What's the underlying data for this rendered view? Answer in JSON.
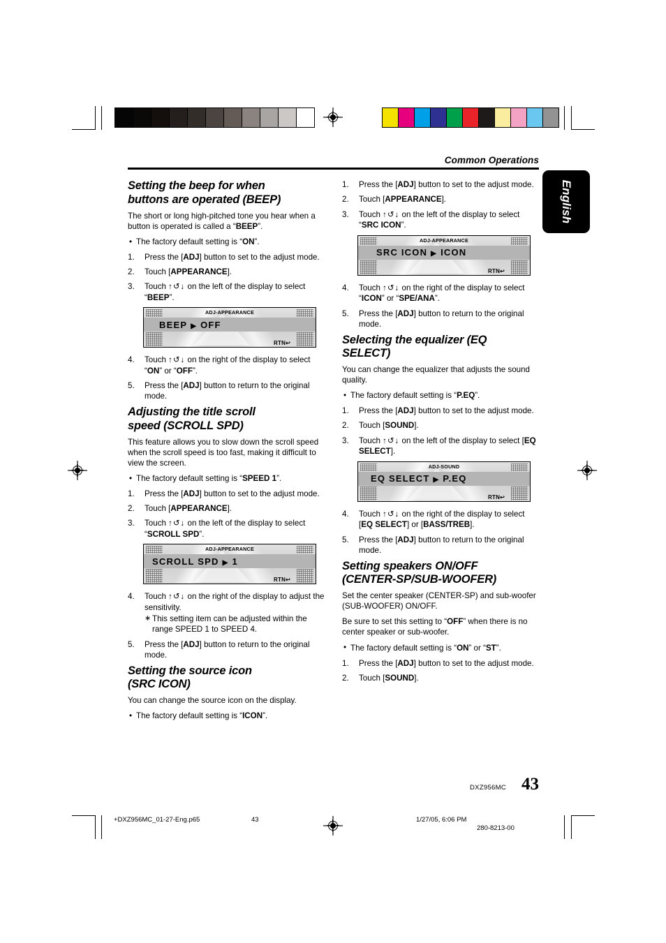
{
  "header": {
    "running_head": "Common Operations",
    "language_tab": "English"
  },
  "footer": {
    "model": "DXZ956MC",
    "page_number": "43",
    "slug_file": "+DXZ956MC_01-27-Eng.p65",
    "slug_page": "43",
    "slug_date": "1/27/05, 6:06 PM",
    "slug_code": "280-8213-00"
  },
  "calibration": {
    "gray_bar": [
      "#050505",
      "#0b0907",
      "#140f0c",
      "#241f1c",
      "#332d29",
      "#4c4441",
      "#645b57",
      "#8a8380",
      "#a9a5a2",
      "#ccc8c6",
      "#ffffff"
    ],
    "color_bar": [
      "#f5e200",
      "#e6007e",
      "#00a0e9",
      "#2e3192",
      "#00a04b",
      "#e8242a",
      "#1e1a19",
      "#faeda0",
      "#f4a3c4",
      "#6ac8f0",
      "#939393"
    ]
  },
  "sections": [
    {
      "id": "beep",
      "column": "left",
      "title": "Setting the beep for when buttons are operated (BEEP)",
      "paragraphs": [
        "The short or long high-pitched tone you hear when a button is operated is called a “BEEP”."
      ],
      "bullets": [
        "The factory default setting is “ON”."
      ],
      "steps": [
        {
          "num": "1.",
          "text": "Press the [ADJ] button to set to the adjust mode."
        },
        {
          "num": "2.",
          "text": "Touch [APPEARANCE]."
        },
        {
          "num": "3.",
          "text": "Touch ↑↺↓ on the left of the display to select “BEEP”."
        },
        {
          "num": "4.",
          "text": "Touch ↑↺↓ on the right of the display to select “ON” or “OFF”."
        },
        {
          "num": "5.",
          "text": "Press the [ADJ] button to return to the original mode."
        }
      ],
      "lcd": {
        "title": "ADJ-APPEARANCE",
        "param": "BEEP",
        "arrow": "▶",
        "value": "OFF",
        "rtn": "RTN↩"
      }
    },
    {
      "id": "scroll-spd",
      "column": "left",
      "title": "Adjusting the title scroll speed (SCROLL SPD)",
      "paragraphs": [
        "This feature allows you to slow down the scroll speed when the scroll speed is too fast, making it difficult to view the screen."
      ],
      "bullets": [
        "The factory default setting is “SPEED 1”."
      ],
      "steps": [
        {
          "num": "1.",
          "text": "Press the [ADJ] button to set to the adjust mode."
        },
        {
          "num": "2.",
          "text": "Touch [APPEARANCE]."
        },
        {
          "num": "3.",
          "text": "Touch ↑↺↓ on the left of the display to select “SCROLL SPD”."
        },
        {
          "num": "4.",
          "text": "Touch ↑↺↓ on the right of the display to adjust the sensitivity.",
          "substep": "This setting item can be adjusted within the range SPEED 1 to SPEED 4."
        },
        {
          "num": "5.",
          "text": "Press the [ADJ] button to return to the original mode."
        }
      ],
      "lcd": {
        "title": "ADJ-APPEARANCE",
        "param": "SCROLL SPD",
        "arrow": "▶",
        "value": "1",
        "rtn": "RTN↩"
      }
    },
    {
      "id": "src-icon",
      "column": "left-right",
      "title": "Setting the source icon (SRC ICON)",
      "paragraphs": [
        "You can change the source icon on the display."
      ],
      "bullets": [
        "The factory default setting is “ICON”."
      ],
      "steps": [
        {
          "num": "1.",
          "text": "Press the [ADJ] button to set to the adjust mode."
        },
        {
          "num": "2.",
          "text": "Touch [APPEARANCE]."
        },
        {
          "num": "3.",
          "text": "Touch ↑↺↓ on the left of the display to select “SRC ICON”."
        },
        {
          "num": "4.",
          "text": "Touch ↑↺↓ on the right of the display to select “ICON” or “SPE/ANA”."
        },
        {
          "num": "5.",
          "text": "Press the [ADJ] button to return to the original mode."
        }
      ],
      "lcd": {
        "title": "ADJ-APPEARANCE",
        "param": "SRC ICON",
        "arrow": "▶",
        "value": "ICON",
        "rtn": "RTN↩"
      }
    },
    {
      "id": "eq-select",
      "column": "right",
      "title": "Selecting the equalizer (EQ SELECT)",
      "paragraphs": [
        "You can change the equalizer that adjusts the sound quality."
      ],
      "bullets": [
        "The factory default setting is “P.EQ”."
      ],
      "steps": [
        {
          "num": "1.",
          "text": "Press the [ADJ] button to set to the adjust mode."
        },
        {
          "num": "2.",
          "text": "Touch [SOUND]."
        },
        {
          "num": "3.",
          "text": "Touch ↑↺↓ on the left of the display to select [EQ SELECT]."
        },
        {
          "num": "4.",
          "text": "Touch ↑↺↓ on the right of the display to select [EQ SELECT] or [BASS/TREB]."
        },
        {
          "num": "5.",
          "text": "Press the [ADJ] button to return to the original mode."
        }
      ],
      "lcd": {
        "title": "ADJ-SOUND",
        "param": "EQ SELECT",
        "arrow": "▶",
        "value": "P.EQ",
        "rtn": "RTN↩"
      }
    },
    {
      "id": "speakers",
      "column": "right",
      "title": "Setting speakers ON/OFF (CENTER-SP/SUB-WOOFER)",
      "paragraphs": [
        "Set the center speaker (CENTER-SP) and sub-woofer (SUB-WOOFER) ON/OFF.",
        "Be sure to set this setting to “OFF” when there is no center speaker or sub-woofer."
      ],
      "bullets": [
        "The factory default setting is “ON” or “ST”."
      ],
      "steps": [
        {
          "num": "1.",
          "text": "Press the [ADJ] button to set to the adjust mode."
        },
        {
          "num": "2.",
          "text": "Touch [SOUND]."
        }
      ],
      "lcd": null
    }
  ],
  "text": {
    "beep": {
      "title_l1": "Setting the beep for when",
      "title_l2": "buttons are operated (BEEP)",
      "intro_a": "The short or long high-pitched tone you hear when a button is operated is called a “",
      "intro_b": "BEEP",
      "intro_c": "”.",
      "bullet_a": "The factory default setting is “",
      "bullet_b": "ON",
      "bullet_c": "”.",
      "s1_a": "Press the [",
      "s1_b": "ADJ",
      "s1_c": "] button to set to the adjust mode.",
      "s2_a": "Touch [",
      "s2_b": "APPEARANCE",
      "s2_c": "].",
      "s3_a": "Touch ",
      "s3_b": " on the left of the display to select “",
      "s3_c": "BEEP",
      "s3_d": "”.",
      "s4_a": "Touch ",
      "s4_b": " on the right of the display to select “",
      "s4_c": "ON",
      "s4_d": "” or “",
      "s4_e": "OFF",
      "s4_f": "”.",
      "s5_a": "Press the [",
      "s5_b": "ADJ",
      "s5_c": "] button to return to the original mode."
    },
    "scroll": {
      "title_l1": "Adjusting the title scroll",
      "title_l2": "speed (SCROLL SPD)",
      "intro": "This feature allows you to slow down the scroll speed when the scroll speed is too fast, making it difficult to view the screen.",
      "bullet_a": "The factory default setting is “",
      "bullet_b": "SPEED 1",
      "bullet_c": "”.",
      "s3_b": " on the left of the display to select “",
      "s3_c": "SCROLL SPD",
      "s3_d": "”.",
      "s4_b": " on the right of the display to adjust the sensitivity.",
      "s4_sub": "This setting item can be adjusted within the range SPEED 1 to SPEED 4."
    },
    "srcicon": {
      "title_l1": "Setting the source icon",
      "title_l2": "(SRC ICON)",
      "intro": "You can change the source icon on the display.",
      "bullet_a": "The factory default setting is “",
      "bullet_b": "ICON",
      "bullet_c": "”.",
      "s3_b": " on the left of the display to select “",
      "s3_c": "SRC ICON",
      "s3_d": "”.",
      "s4_b": " on the right of the display to select “",
      "s4_c": "ICON",
      "s4_d": "” or “",
      "s4_e": "SPE/ANA",
      "s4_f": "”."
    },
    "eq": {
      "title_l1": "Selecting the equalizer (EQ",
      "title_l2": "SELECT)",
      "intro": "You can change the equalizer that adjusts the sound quality.",
      "bullet_a": "The factory default setting is “",
      "bullet_b": "P.EQ",
      "bullet_c": "”.",
      "s2_b": "SOUND",
      "s3_b": " on the left of the display to select [",
      "s3_c": "EQ SELECT",
      "s3_d": "].",
      "s4_b": " on the right of the display to select [",
      "s4_c": "EQ SELECT",
      "s4_d": "] or [",
      "s4_e": "BASS/TREB",
      "s4_f": "]."
    },
    "spk": {
      "title_l1": "Setting speakers ON/OFF",
      "title_l2": "(CENTER-SP/SUB-WOOFER)",
      "intro1": "Set the center speaker (CENTER-SP) and sub-woofer (SUB-WOOFER) ON/OFF.",
      "intro2_a": "Be sure to set this setting to “",
      "intro2_b": "OFF",
      "intro2_c": "” when there is no center speaker or sub-woofer.",
      "bullet_a": "The factory default setting is “",
      "bullet_b": "ON",
      "bullet_c": "” or “",
      "bullet_d": "ST",
      "bullet_e": "”.",
      "s2_b": "SOUND"
    },
    "common": {
      "num1": "1.",
      "num2": "2.",
      "num3": "3.",
      "num4": "4.",
      "num5": "5.",
      "touch_glyph": "↑↺↓",
      "press_a": "Press the [",
      "adj": "ADJ",
      "press_adjust_c": "] button to set to the adjust mode.",
      "press_return_c": "] button to return to the original mode.",
      "touch_open": "Touch [",
      "touch_close": "].",
      "touch_word": "Touch ",
      "appearance": "APPEARANCE"
    }
  }
}
